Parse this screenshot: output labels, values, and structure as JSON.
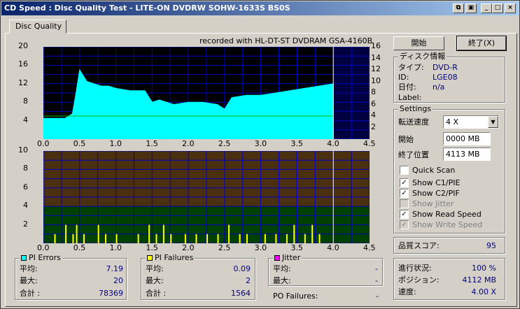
{
  "window": {
    "title": "CD Speed : Disc Quality Test - LITE-ON DVDRW SOHW-1633S BS0S"
  },
  "tab": {
    "label": "Disc Quality"
  },
  "recorded": "recorded with HL-DT-ST DVDRAM GSA-4160B",
  "buttons": {
    "start": "開始",
    "stop": "終了(X)"
  },
  "disc_info": {
    "title": "ディスク情報",
    "type_label": "タイプ:",
    "type_value": "DVD-R",
    "id_label": "ID:",
    "id_value": "LGE08",
    "date_label": "日付:",
    "date_value": "n/a",
    "label_label": "Label:",
    "label_value": ""
  },
  "settings": {
    "title": "Settings",
    "speed_label": "転送速度",
    "speed_value": "4 X",
    "start_label": "開始",
    "start_value": "0000 MB",
    "end_label": "終了位置",
    "end_value": "4113 MB",
    "quick_scan": "Quick Scan",
    "show_c1": "Show C1/PIE",
    "show_c2": "Show C2/PIF",
    "show_jitter": "Show Jitter",
    "show_read": "Show Read Speed",
    "show_write": "Show Write Speed"
  },
  "quality": {
    "label": "品質スコア:",
    "value": "95"
  },
  "progress": {
    "progress_label": "進行状況:",
    "progress_value": "100 %",
    "position_label": "ポジション:",
    "position_value": "4112 MB",
    "speed_label": "速度:",
    "speed_value": "4.00 X"
  },
  "pi_errors": {
    "title": "PI Errors",
    "avg_label": "平均:",
    "avg": "7.19",
    "max_label": "最大:",
    "max": "20",
    "total_label": "合計 :",
    "total": "78369"
  },
  "pi_failures": {
    "title": "PI Failures",
    "avg_label": "平均:",
    "avg": "0.09",
    "max_label": "最大:",
    "max": "2",
    "total_label": "合計 :",
    "total": "1564"
  },
  "jitter": {
    "title": "Jitter",
    "avg_label": "平均:",
    "avg": "-",
    "max_label": "最大:",
    "max": "-"
  },
  "po_failures": {
    "label": "PO Failures:",
    "value": "-"
  },
  "colors": {
    "pie": "#00ffff",
    "pif": "#ffff00",
    "jitter": "#ff00ff",
    "grid": "#0000c0",
    "speed": "#00c000"
  },
  "chart_data": [
    {
      "type": "area",
      "name": "PI Errors",
      "x_ticks": [
        "0.0",
        "0.5",
        "1.0",
        "1.5",
        "2.0",
        "2.5",
        "3.0",
        "3.5",
        "4.0",
        "4.5"
      ],
      "y_left_ticks": [
        "20",
        "16",
        "12",
        "8",
        "4"
      ],
      "y_right_ticks": [
        "16",
        "14",
        "12",
        "10",
        "8",
        "6",
        "4",
        "2"
      ],
      "xlim": [
        0,
        4.5
      ],
      "ylim": [
        0,
        20
      ],
      "x": [
        0.0,
        0.1,
        0.2,
        0.3,
        0.4,
        0.45,
        0.5,
        0.6,
        0.7,
        0.8,
        0.9,
        1.0,
        1.2,
        1.4,
        1.5,
        1.6,
        1.8,
        2.0,
        2.2,
        2.4,
        2.5,
        2.6,
        2.8,
        3.0,
        3.2,
        3.4,
        3.6,
        3.8,
        4.0
      ],
      "values": [
        4.5,
        4.5,
        4.5,
        4.5,
        5.5,
        10,
        15,
        12.5,
        12,
        11.5,
        11.5,
        11,
        10.5,
        10.5,
        8,
        8.5,
        7.5,
        8,
        8,
        7.5,
        6.5,
        9,
        9.5,
        9.5,
        10,
        10.5,
        11,
        11.5,
        12
      ],
      "read_speed": 5
    },
    {
      "type": "bar",
      "name": "PI Failures",
      "x_ticks": [
        "0.0",
        "0.5",
        "1.0",
        "1.5",
        "2.0",
        "2.5",
        "3.0",
        "3.5",
        "4.0",
        "4.5"
      ],
      "y_ticks": [
        "10",
        "8",
        "6",
        "4",
        "2"
      ],
      "xlim": [
        0,
        4.5
      ],
      "ylim": [
        0,
        10
      ],
      "x": [
        0.15,
        0.3,
        0.4,
        0.45,
        0.55,
        0.75,
        0.85,
        1.0,
        1.3,
        1.45,
        1.55,
        1.65,
        1.75,
        1.95,
        2.1,
        2.25,
        2.4,
        2.55,
        2.7,
        2.8,
        3.05,
        3.2,
        3.35,
        3.45,
        3.6,
        3.7,
        3.8
      ],
      "values": [
        1,
        2,
        1,
        2,
        1,
        2,
        1,
        1,
        1,
        2,
        1,
        2,
        1,
        1,
        1,
        1,
        1,
        2,
        1,
        1,
        1,
        1,
        1,
        2,
        1,
        2,
        1
      ]
    }
  ]
}
